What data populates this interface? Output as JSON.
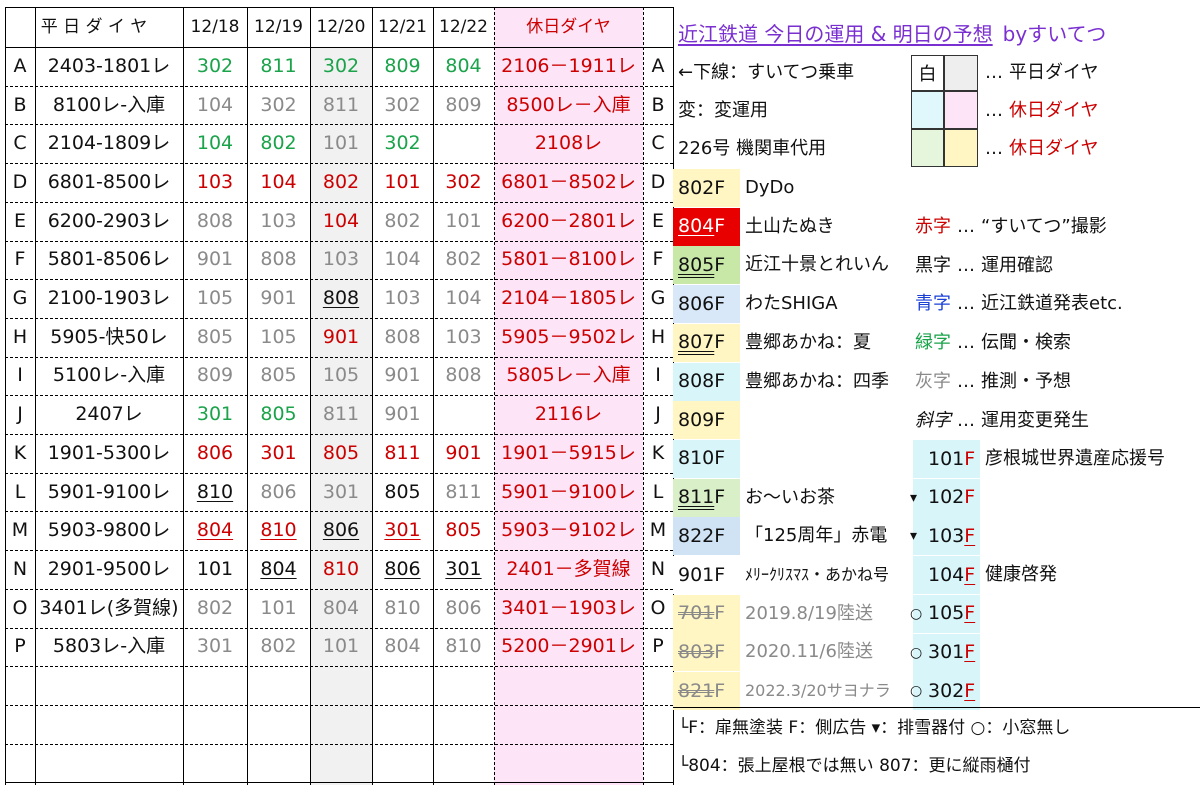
{
  "header": {
    "weekday_label": "平 日 ダ イ ヤ",
    "dates": [
      "12/18",
      "12/19",
      "12/20",
      "12/21",
      "12/22"
    ],
    "holiday_label": "休日ダイヤ"
  },
  "rows": [
    {
      "id": "A",
      "weekday": "2403-1801レ",
      "d": [
        [
          "302",
          "green",
          ""
        ],
        [
          "811",
          "green",
          ""
        ],
        [
          "302",
          "green",
          ""
        ],
        [
          "809",
          "green",
          ""
        ],
        [
          "804",
          "green",
          ""
        ]
      ],
      "holiday": "2106－1911レ"
    },
    {
      "id": "B",
      "weekday": "8100レ-入庫",
      "d": [
        [
          "104",
          "gray",
          ""
        ],
        [
          "302",
          "gray",
          ""
        ],
        [
          "811",
          "gray",
          ""
        ],
        [
          "302",
          "gray",
          ""
        ],
        [
          "809",
          "gray",
          ""
        ]
      ],
      "holiday": "8500レ－入庫"
    },
    {
      "id": "C",
      "weekday": "2104-1809レ",
      "d": [
        [
          "104",
          "green",
          ""
        ],
        [
          "802",
          "green",
          ""
        ],
        [
          "101",
          "gray",
          ""
        ],
        [
          "302",
          "green",
          ""
        ],
        [
          "",
          null,
          ""
        ]
      ],
      "holiday": "2108レ"
    },
    {
      "id": "D",
      "weekday": "6801-8500レ",
      "d": [
        [
          "103",
          "red",
          ""
        ],
        [
          "104",
          "red",
          ""
        ],
        [
          "802",
          "red",
          ""
        ],
        [
          "101",
          "red",
          ""
        ],
        [
          "302",
          "red",
          ""
        ]
      ],
      "holiday": "6801－8502レ"
    },
    {
      "id": "E",
      "weekday": "6200-2903レ",
      "d": [
        [
          "808",
          "gray",
          ""
        ],
        [
          "103",
          "gray",
          ""
        ],
        [
          "104",
          "red",
          ""
        ],
        [
          "802",
          "gray",
          ""
        ],
        [
          "101",
          "gray",
          ""
        ]
      ],
      "holiday": "6200－2801レ"
    },
    {
      "id": "F",
      "weekday": "5801-8506レ",
      "d": [
        [
          "901",
          "gray",
          ""
        ],
        [
          "808",
          "gray",
          ""
        ],
        [
          "103",
          "gray",
          ""
        ],
        [
          "104",
          "gray",
          ""
        ],
        [
          "802",
          "gray",
          ""
        ]
      ],
      "holiday": "5801－8100レ"
    },
    {
      "id": "G",
      "weekday": "2100-1903レ",
      "d": [
        [
          "105",
          "gray",
          ""
        ],
        [
          "901",
          "gray",
          ""
        ],
        [
          "808",
          "black",
          "u"
        ],
        [
          "103",
          "gray",
          ""
        ],
        [
          "104",
          "gray",
          ""
        ]
      ],
      "holiday": "2104－1805レ"
    },
    {
      "id": "H",
      "weekday": "5905-快50レ",
      "d": [
        [
          "805",
          "gray",
          ""
        ],
        [
          "105",
          "gray",
          ""
        ],
        [
          "901",
          "red",
          ""
        ],
        [
          "808",
          "gray",
          ""
        ],
        [
          "103",
          "gray",
          ""
        ]
      ],
      "holiday": "5905－9502レ"
    },
    {
      "id": "I",
      "weekday": "5100レ-入庫",
      "d": [
        [
          "809",
          "gray",
          ""
        ],
        [
          "805",
          "gray",
          ""
        ],
        [
          "105",
          "gray",
          ""
        ],
        [
          "901",
          "gray",
          ""
        ],
        [
          "808",
          "gray",
          ""
        ]
      ],
      "holiday": "5805レ－入庫"
    },
    {
      "id": "J",
      "weekday": "2407レ",
      "d": [
        [
          "301",
          "green",
          ""
        ],
        [
          "805",
          "green",
          ""
        ],
        [
          "811",
          "gray",
          ""
        ],
        [
          "901",
          "gray",
          ""
        ],
        [
          "",
          null,
          ""
        ]
      ],
      "holiday": "2116レ"
    },
    {
      "id": "K",
      "weekday": "1901-5300レ",
      "d": [
        [
          "806",
          "red",
          ""
        ],
        [
          "301",
          "red",
          ""
        ],
        [
          "805",
          "red",
          ""
        ],
        [
          "811",
          "red",
          ""
        ],
        [
          "901",
          "red",
          ""
        ]
      ],
      "holiday": "1901－5915レ"
    },
    {
      "id": "L",
      "weekday": "5901-9100レ",
      "d": [
        [
          "810",
          "black",
          "u"
        ],
        [
          "806",
          "gray",
          ""
        ],
        [
          "301",
          "gray",
          ""
        ],
        [
          "805",
          "black",
          ""
        ],
        [
          "811",
          "gray",
          ""
        ]
      ],
      "holiday": "5901－9100レ"
    },
    {
      "id": "M",
      "weekday": "5903-9800レ",
      "d": [
        [
          "804",
          "red",
          "u"
        ],
        [
          "810",
          "red",
          "u"
        ],
        [
          "806",
          "black",
          "u"
        ],
        [
          "301",
          "red",
          "u"
        ],
        [
          "805",
          "red",
          ""
        ]
      ],
      "holiday": "5903－9102レ"
    },
    {
      "id": "N",
      "weekday": "2901-9500レ",
      "d": [
        [
          "101",
          "black",
          ""
        ],
        [
          "804",
          "black",
          "u"
        ],
        [
          "810",
          "red",
          ""
        ],
        [
          "806",
          "black",
          "u"
        ],
        [
          "301",
          "black",
          "u"
        ]
      ],
      "holiday": "2401－多賀線"
    },
    {
      "id": "O",
      "weekday": "3401レ(多賀線)",
      "d": [
        [
          "802",
          "gray",
          ""
        ],
        [
          "101",
          "gray",
          ""
        ],
        [
          "804",
          "gray",
          ""
        ],
        [
          "810",
          "gray",
          ""
        ],
        [
          "806",
          "gray",
          ""
        ]
      ],
      "holiday": "3401－1903レ"
    },
    {
      "id": "P",
      "weekday": "5803レ-入庫",
      "d": [
        [
          "301",
          "gray",
          ""
        ],
        [
          "802",
          "gray",
          ""
        ],
        [
          "101",
          "gray",
          ""
        ],
        [
          "804",
          "gray",
          ""
        ],
        [
          "810",
          "gray",
          ""
        ]
      ],
      "holiday": "5200－2901レ"
    }
  ],
  "legend": {
    "title": "近江鉄道 今日の運用 & 明日の予想",
    "byline": "byすいてつ",
    "notes": [
      {
        "text": "←下線：すいてつ乗車"
      },
      {
        "text": "変：変運用"
      },
      {
        "text": "226号 機関車代用"
      }
    ],
    "swatch_white_label": "白",
    "swatch_rows": [
      {
        "dots": "…",
        "text": "平日ダイヤ",
        "color": "black"
      },
      {
        "dots": "…",
        "text": "休日ダイヤ",
        "color": "red"
      },
      {
        "dots": "…",
        "text": "休日ダイヤ",
        "color": "red"
      }
    ],
    "trains": [
      {
        "num": "802",
        "suffix": "F",
        "name": "DyDo",
        "bg": "#fff6c4",
        "numcolor": "black",
        "numstyle": ""
      },
      {
        "num": "804",
        "suffix": "F",
        "name": "土山たぬき",
        "bg": "#e80000",
        "numcolor": "white",
        "numstyle": "u"
      },
      {
        "num": "805",
        "suffix": "F",
        "name": "近江十景とれいん",
        "bg": "#c8e8a8",
        "numcolor": "black",
        "numstyle": "uu"
      },
      {
        "num": "806",
        "suffix": "F",
        "name": "わたSHIGA",
        "bg": "#d8e8f8",
        "numcolor": "black",
        "numstyle": ""
      },
      {
        "num": "807",
        "suffix": "F",
        "name": "豊郷あかね：夏",
        "bg": "#fff6c4",
        "numcolor": "black",
        "numstyle": "uu"
      },
      {
        "num": "808",
        "suffix": "F",
        "name": "豊郷あかね：四季",
        "bg": "#d8f6fa",
        "numcolor": "black",
        "numstyle": ""
      },
      {
        "num": "809",
        "suffix": "F",
        "name": "",
        "bg": "#fff6c4",
        "numcolor": "black",
        "numstyle": ""
      },
      {
        "num": "810",
        "suffix": "F",
        "name": "",
        "bg": "#d8f6fa",
        "numcolor": "black",
        "numstyle": ""
      },
      {
        "num": "811",
        "suffix": "F",
        "name": "お～いお茶",
        "bg": "#d8efc8",
        "numcolor": "black",
        "numstyle": "uu"
      },
      {
        "num": "822",
        "suffix": "F",
        "name": "「125周年」赤電",
        "bg": "#cfe3f5",
        "numcolor": "black",
        "numstyle": ""
      },
      {
        "num": "901",
        "suffix": "F",
        "name": "ﾒﾘｰｸﾘｽﾏｽ・あかね号",
        "bg": "#ffffff",
        "numcolor": "black",
        "numstyle": ""
      },
      {
        "num": "701",
        "suffix": "F",
        "name": "2019.8/19陸送",
        "bg": "#fff6c4",
        "numcolor": "gray",
        "numstyle": "ss"
      },
      {
        "num": "803",
        "suffix": "F",
        "name": "2020.11/6陸送",
        "bg": "#fff6c4",
        "numcolor": "gray",
        "numstyle": "ss"
      },
      {
        "num": "821",
        "suffix": "F",
        "name": "2022.3/20サヨナラ",
        "bg": "#fff6c4",
        "numcolor": "gray",
        "numstyle": "ss"
      }
    ],
    "source_key": [
      {
        "label": "赤字",
        "color": "red",
        "text": "“すいてつ”撮影"
      },
      {
        "label": "黒字",
        "color": "black",
        "text": "運用確認"
      },
      {
        "label": "青字",
        "color": "blue",
        "text": "近江鉄道発表etc."
      },
      {
        "label": "緑字",
        "color": "green",
        "text": "伝聞・検索"
      },
      {
        "label": "灰字",
        "color": "gray",
        "text": "推測・予想"
      },
      {
        "label": "斜字",
        "color": "black",
        "text": "運用変更発生"
      }
    ],
    "small_dots": "…",
    "locos": [
      {
        "mark": "",
        "num": "101",
        "text": "彦根城世界遺産応援号",
        "redF": true
      },
      {
        "mark": "▾",
        "num": "102",
        "text": "",
        "redF": true
      },
      {
        "mark": "▾",
        "num": "103",
        "text": "",
        "redF": true
      },
      {
        "mark": "",
        "num": "104",
        "text": "健康啓発",
        "redF": true
      },
      {
        "mark": "○",
        "num": "105",
        "text": "",
        "redF": true
      },
      {
        "mark": "○",
        "num": "301",
        "text": "",
        "redF": true
      },
      {
        "mark": "○",
        "num": "302",
        "text": "",
        "redF": true
      }
    ],
    "footer1": "└F：扉無塗装  F：側広告  ▾：排雪器付  ○：小窓無し",
    "footer2": "└804：張上屋根では無い  807：更に縦雨樋付"
  }
}
